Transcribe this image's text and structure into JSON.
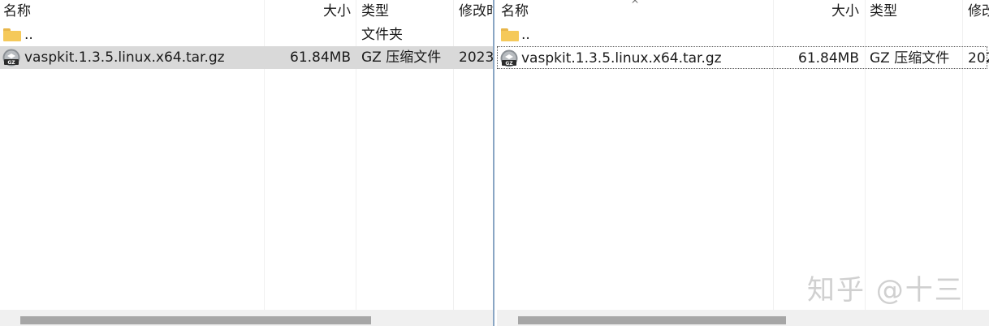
{
  "left_pane": {
    "columns": [
      {
        "key": "name",
        "label": "名称"
      },
      {
        "key": "size",
        "label": "大小"
      },
      {
        "key": "type",
        "label": "类型"
      },
      {
        "key": "modified",
        "label": "修改时"
      }
    ],
    "rows": [
      {
        "name": "..",
        "size": "",
        "type": "文件夹",
        "modified": "",
        "icon": "folder-icon"
      },
      {
        "name": "vaspkit.1.3.5.linux.x64.tar.gz",
        "size": "61.84MB",
        "type": "GZ 压缩文件",
        "modified": "2023",
        "icon": "gz-archive-icon"
      }
    ]
  },
  "right_pane": {
    "sort_indicator": "^",
    "columns": [
      {
        "key": "name",
        "label": "名称"
      },
      {
        "key": "size",
        "label": "大小"
      },
      {
        "key": "type",
        "label": "类型"
      },
      {
        "key": "modified",
        "label": "修改"
      }
    ],
    "rows": [
      {
        "name": "..",
        "size": "",
        "type": "",
        "modified": "",
        "icon": "folder-icon"
      },
      {
        "name": "vaspkit.1.3.5.linux.x64.tar.gz",
        "size": "61.84MB",
        "type": "GZ 压缩文件",
        "modified": "202",
        "icon": "gz-archive-icon"
      }
    ]
  },
  "scrollbar": {
    "left_thumb_fraction": 0.72,
    "right_thumb_fraction": 0.55
  },
  "icon_labels": {
    "gz": "GZ"
  },
  "colors": {
    "selected_row": "#d9d9d9",
    "splitter": "#8aa6c4",
    "folder": "#f5c95a"
  },
  "watermark": "知乎 @十三"
}
